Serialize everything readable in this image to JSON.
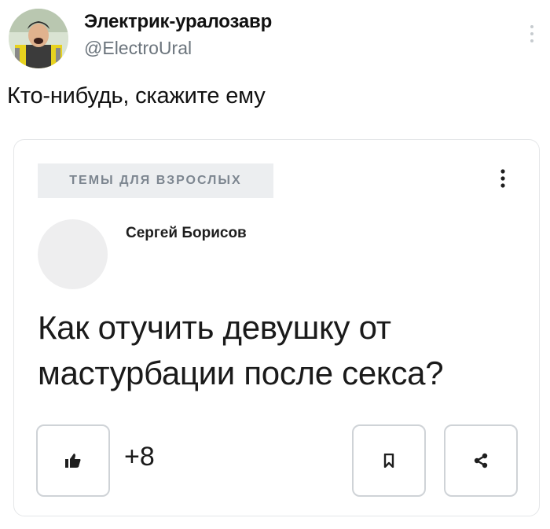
{
  "tweet": {
    "display_name": "Электрик-уралозавр",
    "handle": "@ElectroUral",
    "text": "Кто-нибудь, скажите ему"
  },
  "card": {
    "topic": "ТЕМЫ ДЛЯ ВЗРОСЛЫХ",
    "author": "Сергей Борисов",
    "question_line1": "Как отучить девушку от",
    "question_line2": "мастурбации после секса?",
    "like_count": "+8"
  },
  "icons": {
    "tweet_menu": "vertical-dots-icon",
    "card_menu": "vertical-dots-icon",
    "like": "thumbs-up-icon",
    "bookmark": "bookmark-icon",
    "share": "share-icon"
  }
}
